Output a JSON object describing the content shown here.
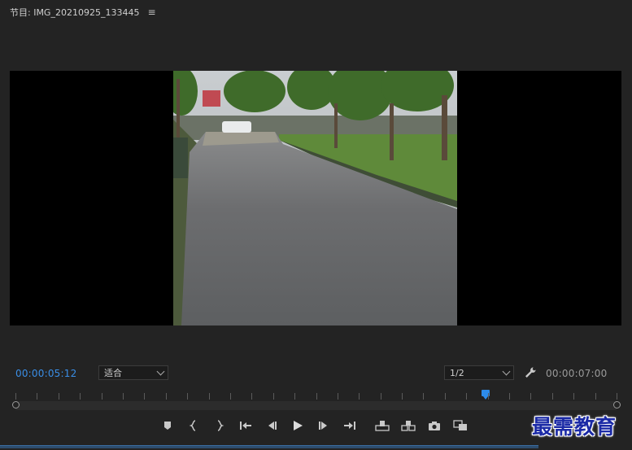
{
  "panel": {
    "title": "节目: IMG_20210925_133445",
    "menu_icon": "hamburger-icon"
  },
  "timecodes": {
    "current": "00:00:05:12",
    "total": "00:00:07:00"
  },
  "fit_select": {
    "value": "适合"
  },
  "resolution_select": {
    "value": "1/2"
  },
  "timeline": {
    "playhead_fraction": 0.782
  },
  "transport_icons": [
    "add-marker-icon",
    "mark-in-icon",
    "mark-out-icon",
    "go-to-in-icon",
    "step-back-icon",
    "play-icon",
    "step-forward-icon",
    "go-to-out-icon",
    "lift-icon",
    "extract-icon",
    "export-frame-icon",
    "compare-view-icon"
  ],
  "watermark": "最需教育",
  "colors": {
    "accent_blue": "#3a8ee6",
    "panel_bg": "#232323"
  }
}
